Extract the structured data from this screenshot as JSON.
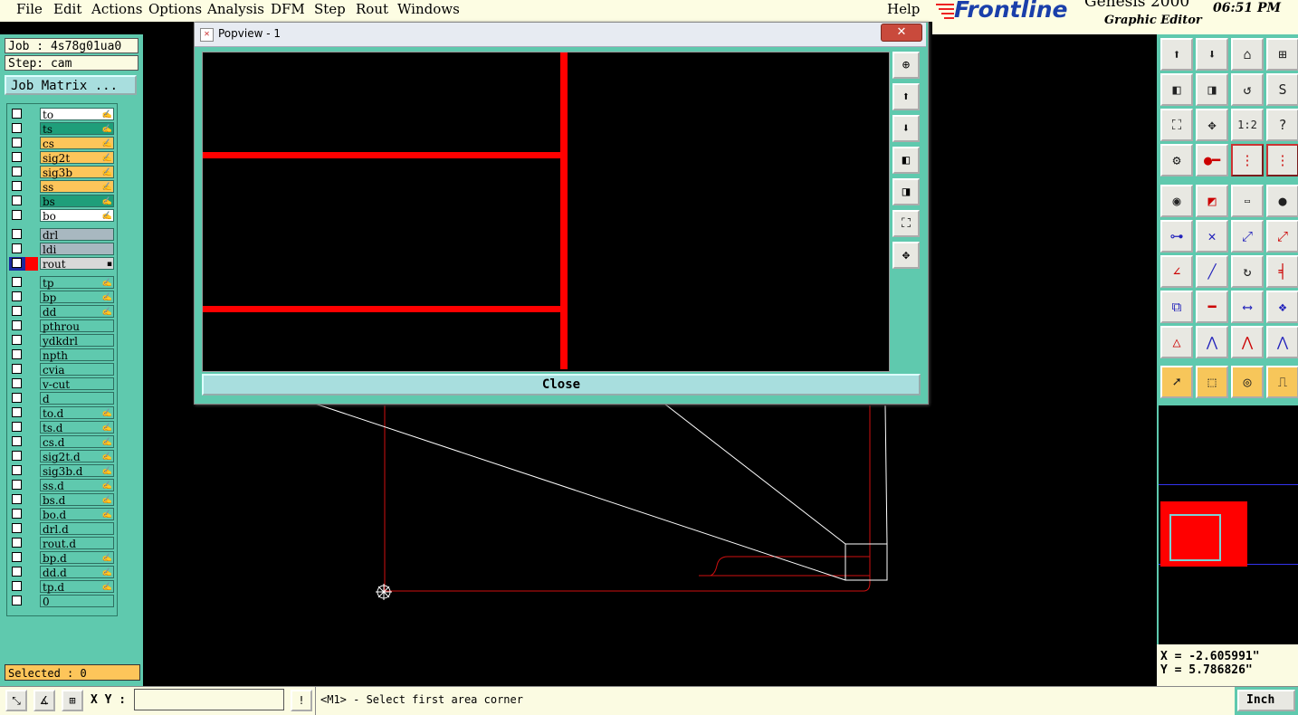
{
  "menubar": {
    "items": [
      "File",
      "Edit",
      "Actions",
      "Options",
      "Analysis",
      "DFM",
      "Step",
      "Rout",
      "Windows"
    ],
    "help": "Help"
  },
  "brand": {
    "logo": "Frontline",
    "product": "Genesis 2000",
    "subtitle": "Graphic Editor",
    "time": "06:51 PM"
  },
  "job": {
    "job_label": "Job : 4s78g01ua0",
    "step_label": "Step: cam",
    "matrix_button": "Job Matrix ..."
  },
  "layers": [
    {
      "name": "to",
      "color": "#ffffff",
      "mark": "✍"
    },
    {
      "name": "ts",
      "color": "#1f9e7a",
      "mark": "✍"
    },
    {
      "name": "cs",
      "color": "#fdc55a",
      "mark": "✍"
    },
    {
      "name": "sig2t",
      "color": "#fdc55a",
      "mark": "✍"
    },
    {
      "name": "sig3b",
      "color": "#fdc55a",
      "mark": "✍"
    },
    {
      "name": "ss",
      "color": "#fdc55a",
      "mark": "✍"
    },
    {
      "name": "bs",
      "color": "#1f9e7a",
      "mark": "✍"
    },
    {
      "name": "bo",
      "color": "#ffffff",
      "mark": "✍"
    },
    {
      "name": "drl",
      "color": "#a8b8c0",
      "mark": ""
    },
    {
      "name": "ldi",
      "color": "#a8b8c0",
      "mark": ""
    },
    {
      "name": "rout",
      "color": "#d8d8d8",
      "mark": "▪"
    },
    {
      "name": "tp",
      "color": "#5fc9ae",
      "mark": "✍"
    },
    {
      "name": "bp",
      "color": "#5fc9ae",
      "mark": "✍"
    },
    {
      "name": "dd",
      "color": "#5fc9ae",
      "mark": "✍"
    },
    {
      "name": "pthrou",
      "color": "#5fc9ae",
      "mark": ""
    },
    {
      "name": "ydkdrl",
      "color": "#5fc9ae",
      "mark": ""
    },
    {
      "name": "npth",
      "color": "#5fc9ae",
      "mark": ""
    },
    {
      "name": "cvia",
      "color": "#5fc9ae",
      "mark": ""
    },
    {
      "name": "v-cut",
      "color": "#5fc9ae",
      "mark": ""
    },
    {
      "name": "d",
      "color": "#5fc9ae",
      "mark": ""
    },
    {
      "name": "to.d",
      "color": "#5fc9ae",
      "mark": "✍"
    },
    {
      "name": "ts.d",
      "color": "#5fc9ae",
      "mark": "✍"
    },
    {
      "name": "cs.d",
      "color": "#5fc9ae",
      "mark": "✍"
    },
    {
      "name": "sig2t.d",
      "color": "#5fc9ae",
      "mark": "✍"
    },
    {
      "name": "sig3b.d",
      "color": "#5fc9ae",
      "mark": "✍"
    },
    {
      "name": "ss.d",
      "color": "#5fc9ae",
      "mark": "✍"
    },
    {
      "name": "bs.d",
      "color": "#5fc9ae",
      "mark": "✍"
    },
    {
      "name": "bo.d",
      "color": "#5fc9ae",
      "mark": "✍"
    },
    {
      "name": "drl.d",
      "color": "#5fc9ae",
      "mark": ""
    },
    {
      "name": "rout.d",
      "color": "#5fc9ae",
      "mark": ""
    },
    {
      "name": "bp.d",
      "color": "#5fc9ae",
      "mark": "✍"
    },
    {
      "name": "dd.d",
      "color": "#5fc9ae",
      "mark": "✍"
    },
    {
      "name": "tp.d",
      "color": "#5fc9ae",
      "mark": "✍"
    },
    {
      "name": "0",
      "color": "#5fc9ae",
      "mark": ""
    }
  ],
  "status": {
    "selected": "Selected : 0"
  },
  "coords": {
    "x": "X = -2.605991\"",
    "y": "Y = 5.786826\""
  },
  "bottom": {
    "xy_label": "X Y :",
    "xy_value": "",
    "prompt": "<M1> - Select first area corner",
    "units": "Inch"
  },
  "popup": {
    "title": "Popview - 1",
    "close_label": "Close"
  },
  "colors": {
    "panel": "#5fc9ae",
    "cream": "#fbfbe2",
    "feature": "#ff0000"
  }
}
